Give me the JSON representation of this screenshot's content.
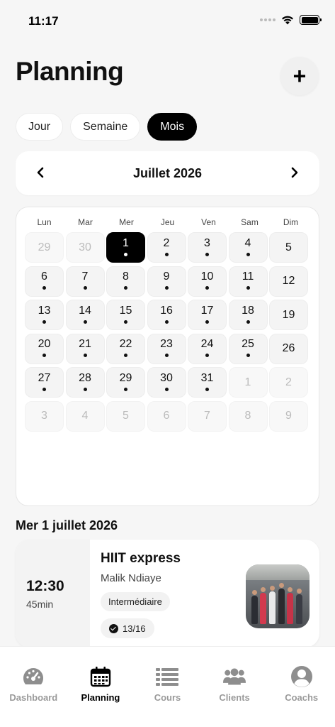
{
  "status_bar": {
    "time": "11:17"
  },
  "header": {
    "title": "Planning",
    "add_label": "+"
  },
  "view_tabs": [
    {
      "label": "Jour",
      "active": false
    },
    {
      "label": "Semaine",
      "active": false
    },
    {
      "label": "Mois",
      "active": true
    }
  ],
  "calendar": {
    "month_label": "Juillet 2026",
    "prev_icon": "chevron-left-icon",
    "next_icon": "chevron-right-icon",
    "weekdays": [
      "Lun",
      "Mar",
      "Mer",
      "Jeu",
      "Ven",
      "Sam",
      "Dim"
    ],
    "days": [
      {
        "num": "29",
        "muted": true,
        "dot": false
      },
      {
        "num": "30",
        "muted": true,
        "dot": false
      },
      {
        "num": "1",
        "muted": false,
        "dot": true,
        "selected": true
      },
      {
        "num": "2",
        "muted": false,
        "dot": true
      },
      {
        "num": "3",
        "muted": false,
        "dot": true
      },
      {
        "num": "4",
        "muted": false,
        "dot": true
      },
      {
        "num": "5",
        "muted": false,
        "dot": false
      },
      {
        "num": "6",
        "muted": false,
        "dot": true
      },
      {
        "num": "7",
        "muted": false,
        "dot": true
      },
      {
        "num": "8",
        "muted": false,
        "dot": true
      },
      {
        "num": "9",
        "muted": false,
        "dot": true
      },
      {
        "num": "10",
        "muted": false,
        "dot": true
      },
      {
        "num": "11",
        "muted": false,
        "dot": true
      },
      {
        "num": "12",
        "muted": false,
        "dot": false
      },
      {
        "num": "13",
        "muted": false,
        "dot": true
      },
      {
        "num": "14",
        "muted": false,
        "dot": true
      },
      {
        "num": "15",
        "muted": false,
        "dot": true
      },
      {
        "num": "16",
        "muted": false,
        "dot": true
      },
      {
        "num": "17",
        "muted": false,
        "dot": true
      },
      {
        "num": "18",
        "muted": false,
        "dot": true
      },
      {
        "num": "19",
        "muted": false,
        "dot": false
      },
      {
        "num": "20",
        "muted": false,
        "dot": true
      },
      {
        "num": "21",
        "muted": false,
        "dot": true
      },
      {
        "num": "22",
        "muted": false,
        "dot": true
      },
      {
        "num": "23",
        "muted": false,
        "dot": true
      },
      {
        "num": "24",
        "muted": false,
        "dot": true
      },
      {
        "num": "25",
        "muted": false,
        "dot": true
      },
      {
        "num": "26",
        "muted": false,
        "dot": false
      },
      {
        "num": "27",
        "muted": false,
        "dot": true
      },
      {
        "num": "28",
        "muted": false,
        "dot": true
      },
      {
        "num": "29",
        "muted": false,
        "dot": true
      },
      {
        "num": "30",
        "muted": false,
        "dot": true
      },
      {
        "num": "31",
        "muted": false,
        "dot": true
      },
      {
        "num": "1",
        "muted": true,
        "dot": false
      },
      {
        "num": "2",
        "muted": true,
        "dot": false
      },
      {
        "num": "3",
        "muted": true,
        "dot": false
      },
      {
        "num": "4",
        "muted": true,
        "dot": false
      },
      {
        "num": "5",
        "muted": true,
        "dot": false
      },
      {
        "num": "6",
        "muted": true,
        "dot": false
      },
      {
        "num": "7",
        "muted": true,
        "dot": false
      },
      {
        "num": "8",
        "muted": true,
        "dot": false
      },
      {
        "num": "9",
        "muted": true,
        "dot": false
      }
    ]
  },
  "selected_date": "Mer 1 juillet 2026",
  "class_card": {
    "time": "12:30",
    "duration": "45min",
    "name": "HIIT express",
    "coach": "Malik Ndiaye",
    "level": "Intermédiaire",
    "capacity": "13/16",
    "capacity_icon": "check-circle-icon"
  },
  "tab_bar": [
    {
      "label": "Dashboard",
      "icon": "dashboard-gauge-icon",
      "active": false
    },
    {
      "label": "Planning",
      "icon": "calendar-icon",
      "active": true
    },
    {
      "label": "Cours",
      "icon": "list-icon",
      "active": false
    },
    {
      "label": "Clients",
      "icon": "users-icon",
      "active": false
    },
    {
      "label": "Coachs",
      "icon": "user-circle-icon",
      "active": false
    }
  ],
  "colors": {
    "accent": "#000000",
    "inactive": "#9a9a9a",
    "background": "#f6f6f6"
  }
}
